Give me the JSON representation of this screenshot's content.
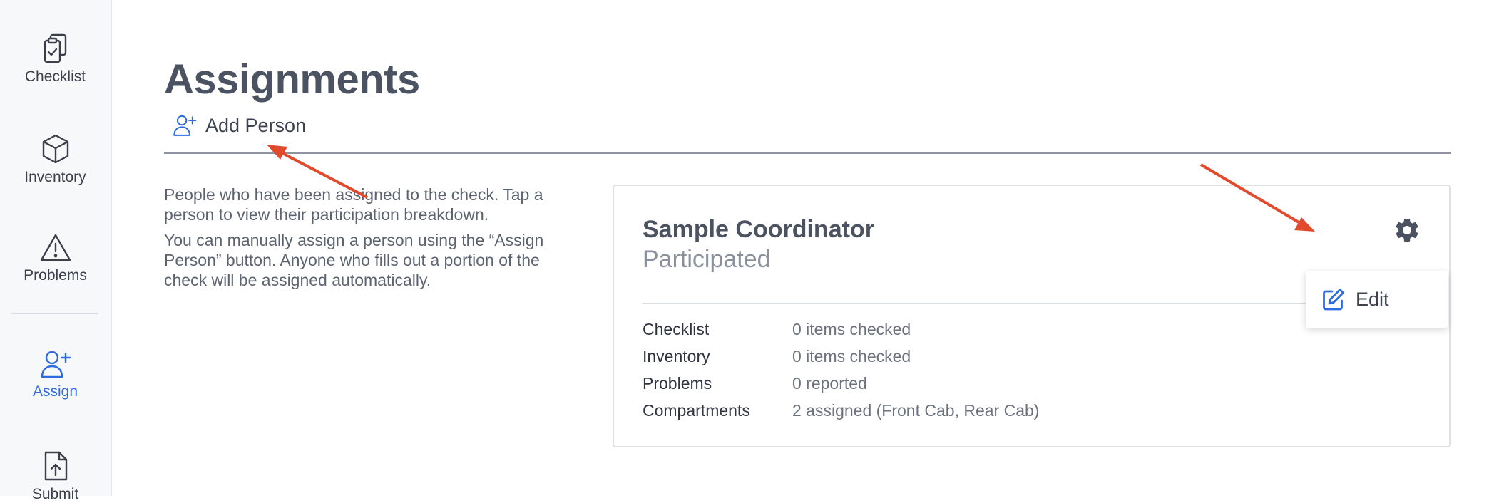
{
  "sidebar": {
    "items": [
      {
        "label": "Checklist",
        "icon": "clipboard-check-icon",
        "active": false
      },
      {
        "label": "Inventory",
        "icon": "cube-icon",
        "active": false
      },
      {
        "label": "Problems",
        "icon": "warning-triangle-icon",
        "active": false
      },
      {
        "label": "Assign",
        "icon": "person-add-icon",
        "active": true
      },
      {
        "label": "Submit",
        "icon": "file-upload-icon",
        "active": false
      }
    ]
  },
  "page": {
    "title": "Assignments",
    "add_person_label": "Add Person",
    "help_p1": "People who have been assigned to the check. Tap a person to view their participation breakdown.",
    "help_p2": "You can manually assign a person using the “Assign Person” button. Anyone who fills out a portion of the check will be assigned automatically."
  },
  "card": {
    "name": "Sample Coordinator",
    "status": "Participated",
    "stats": [
      {
        "key": "Checklist",
        "value": "0 items checked"
      },
      {
        "key": "Inventory",
        "value": "0 items checked"
      },
      {
        "key": "Problems",
        "value": "0 reported"
      },
      {
        "key": "Compartments",
        "value": "2 assigned (Front Cab, Rear Cab)"
      }
    ]
  },
  "menu": {
    "edit_label": "Edit"
  },
  "colors": {
    "accent": "#2f6bde",
    "annotation_arrow": "#e24a2e",
    "text_dark": "#4b5261"
  }
}
